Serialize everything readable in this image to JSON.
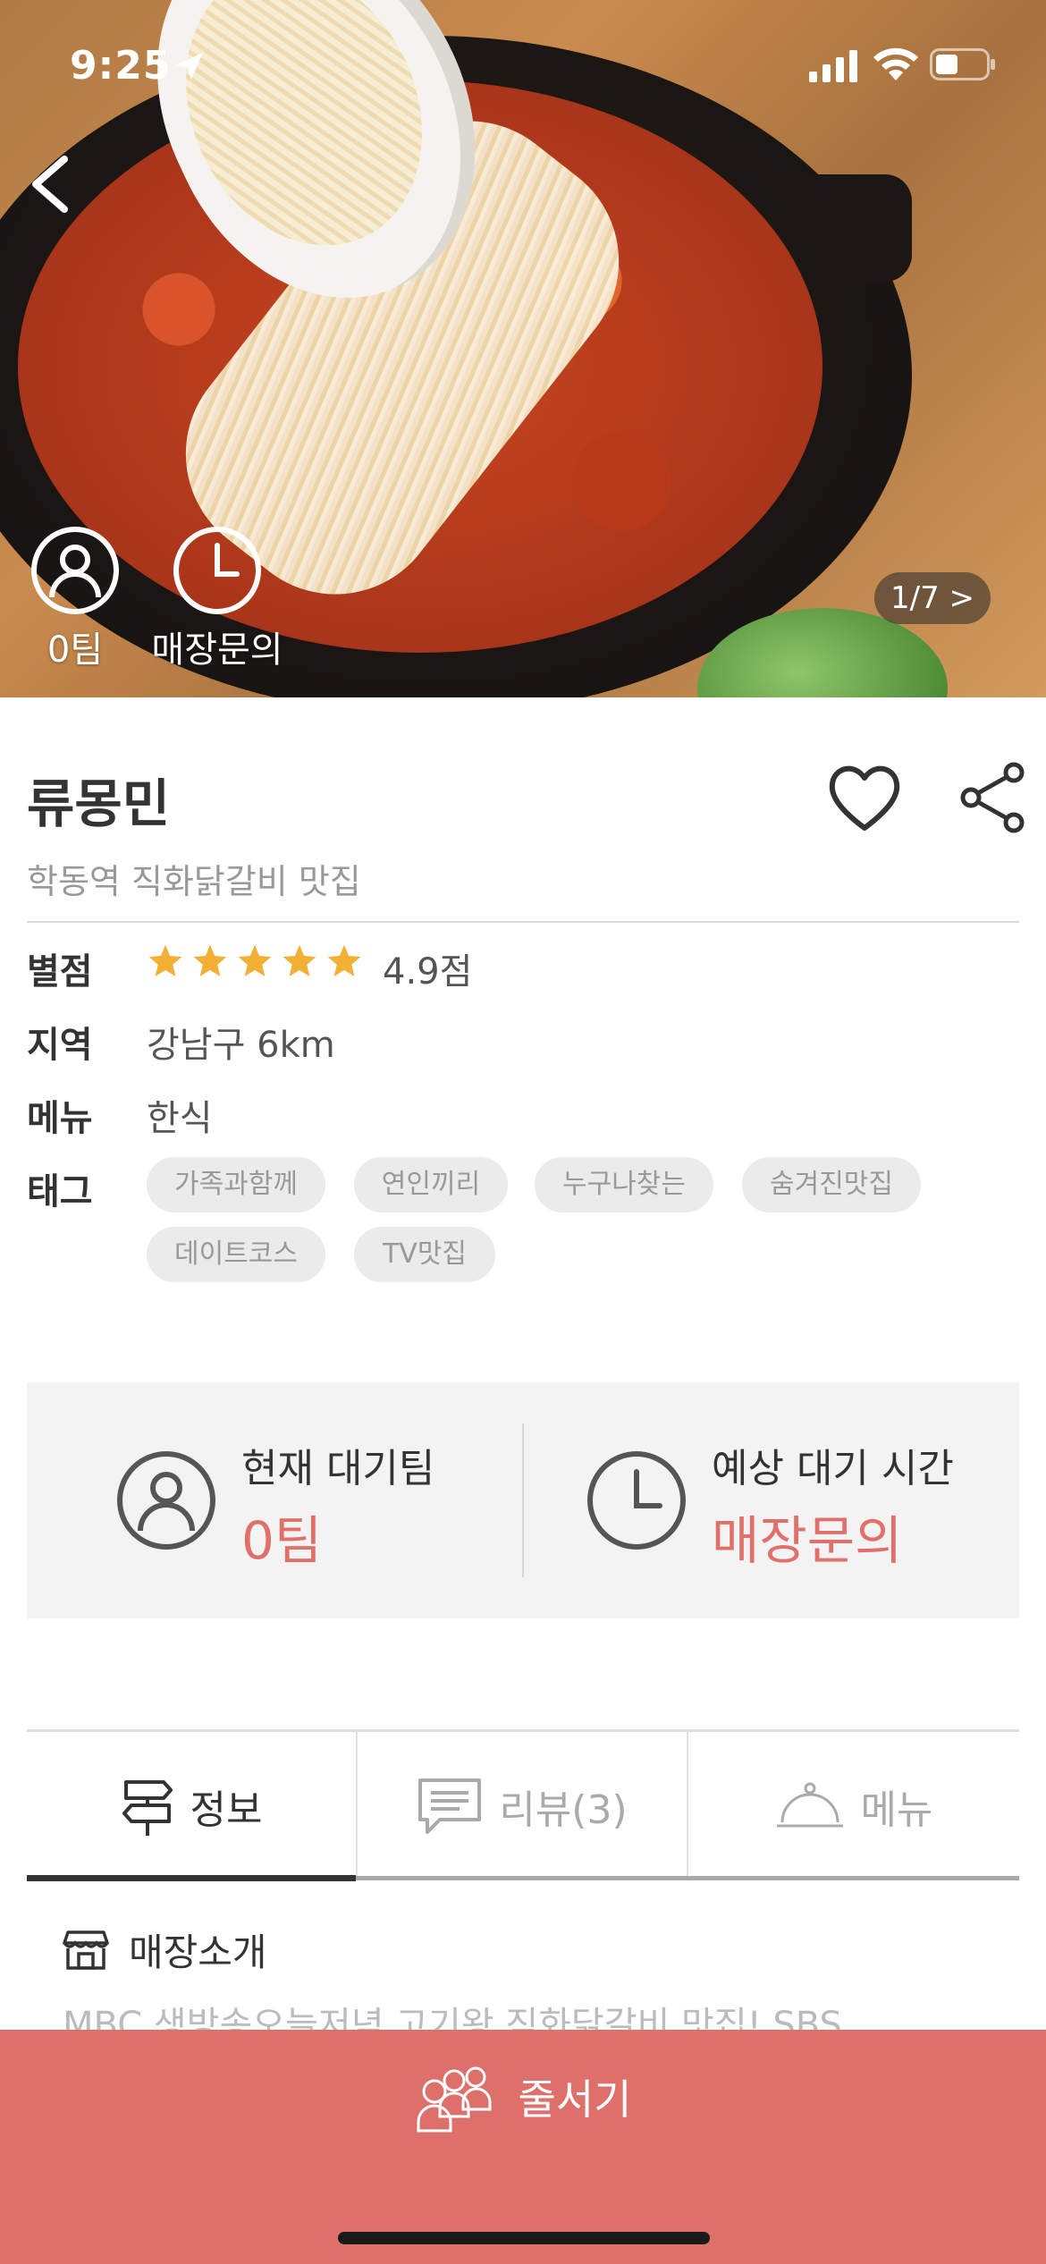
{
  "status_bar": {
    "time": "9:25"
  },
  "hero": {
    "teams_label": "0팀",
    "wait_label": "매장문의",
    "pager": "1/7 >"
  },
  "store": {
    "name": "류몽민",
    "subtitle": "학동역 직화닭갈비 맛집"
  },
  "info": {
    "rating_key": "별점",
    "rating_value": "4.9점",
    "rating_stars": 4.9,
    "region_key": "지역",
    "region_value": "강남구 6km",
    "menu_key": "메뉴",
    "menu_value": "한식",
    "tags_key": "태그",
    "tags": [
      "가족과함께",
      "연인끼리",
      "누구나찾는",
      "숨겨진맛집",
      "데이트코스",
      "TV맛집"
    ]
  },
  "wait_box": {
    "current_label": "현재 대기팀",
    "current_value": "0팀",
    "expected_label": "예상 대기 시간",
    "expected_value": "매장문의"
  },
  "tabs": [
    {
      "label": "정보"
    },
    {
      "label": "리뷰(3)"
    },
    {
      "label": "메뉴"
    }
  ],
  "section": {
    "title": "매장소개",
    "text": "MBC 생방송오늘저녁 고기왕 직화닭갈비 맛집! SBS"
  },
  "cta": {
    "label": "줄서기"
  },
  "colors": {
    "accent": "#de706c",
    "star": "#f2b035",
    "highlight_text": "#e07069"
  }
}
